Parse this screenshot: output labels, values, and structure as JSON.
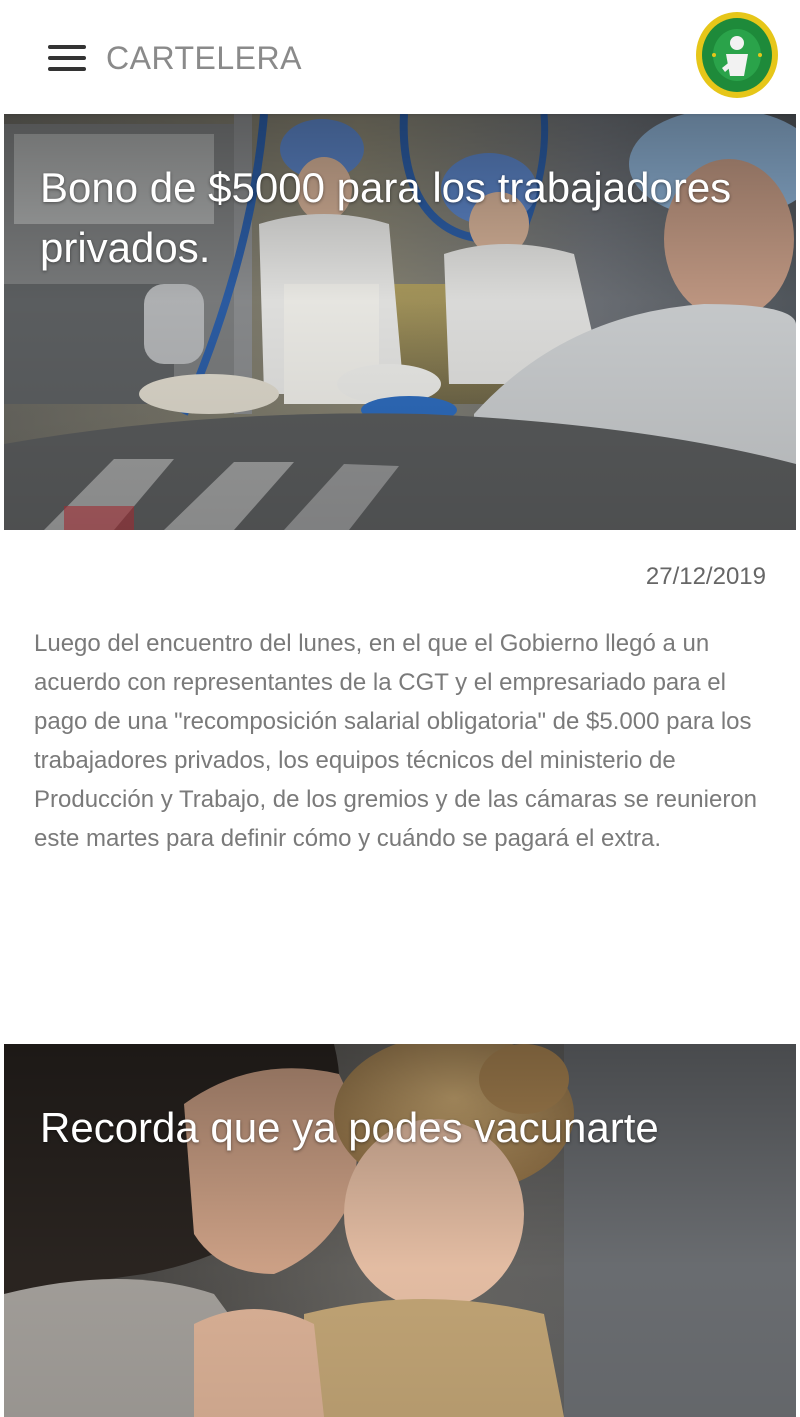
{
  "app": {
    "title": "CARTELERA",
    "menu_icon": "hamburger-menu-icon",
    "logo_icon": "union-crest-logo"
  },
  "colors": {
    "appbar_bg": "#ffffff",
    "title_text": "#8a8a8a",
    "body_text": "#7a7a7a",
    "date_text": "#666666",
    "logo_green": "#1e8a3a",
    "logo_yellow": "#e6c619"
  },
  "news": [
    {
      "title": "Bono de $5000 para los trabajadores privados.",
      "date": "27/12/2019",
      "body": "Luego del encuentro del lunes, en el que el Gobierno llegó a un acuerdo con representantes de la CGT y el empresariado para el pago de una \"recomposición salarial obligatoria\" de $5.000 para los trabajadores privados, los equipos técnicos del ministerio de Producción y Trabajo, de los gremios y de las cámaras se reunieron este martes para definir cómo y cuándo se pagará el extra."
    },
    {
      "title": "Recorda que ya podes vacunarte"
    }
  ]
}
